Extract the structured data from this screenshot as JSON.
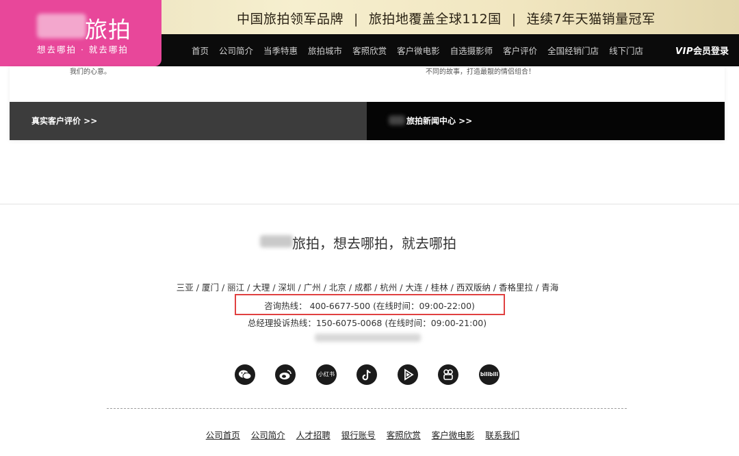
{
  "banner": {
    "slogans": [
      "中国旅拍领军品牌",
      "旅拍地覆盖全球112国",
      "连续7年天猫销量冠军"
    ],
    "separator": "|"
  },
  "logo": {
    "brand": "旅拍",
    "tagline": "想去哪拍 · 就去哪拍",
    "color": "#e8479a"
  },
  "nav": {
    "items": [
      "首页",
      "公司简介",
      "当季特惠",
      "旅拍城市",
      "客照欣赏",
      "客户微电影",
      "自选摄影师",
      "客户评价",
      "全国经销门店",
      "线下门店"
    ],
    "vip_prefix": "VIP",
    "vip_label": "会员登录"
  },
  "card": {
    "left_text": "我们的心意。",
    "right_text": "不同的故事，打造最靓的情侣组合！",
    "bar_left": "真实客户评价 >>",
    "bar_right": "旅拍新闻中心 >>"
  },
  "footer": {
    "title": "旅拍，想去哪拍，就去哪拍",
    "cities": [
      "三亚",
      "厦门",
      "丽江",
      "大理",
      "深圳",
      "广州",
      "北京",
      "成都",
      "杭州",
      "大连",
      "桂林",
      "西双版纳",
      "香格里拉",
      "青海"
    ],
    "hotline": "咨询热线： 400-6677-500 (在线时间：09:00-22:00)",
    "complaint": "总经理投诉热线：150-6075-0068 (在线时间：09:00-21:00)",
    "social_icons": [
      "wechat-icon",
      "weibo-icon",
      "xiaohongshu-icon",
      "douyin-icon",
      "video-play-icon",
      "kuaishou-icon",
      "bilibili-icon"
    ],
    "social_xhs_label": "小红书",
    "social_bili_label": "bilibili",
    "links": [
      "公司首页",
      "公司简介",
      "人才招聘",
      "银行账号",
      "客照欣赏",
      "客户微电影",
      "联系我们"
    ],
    "highlight_color": "#e04040"
  }
}
